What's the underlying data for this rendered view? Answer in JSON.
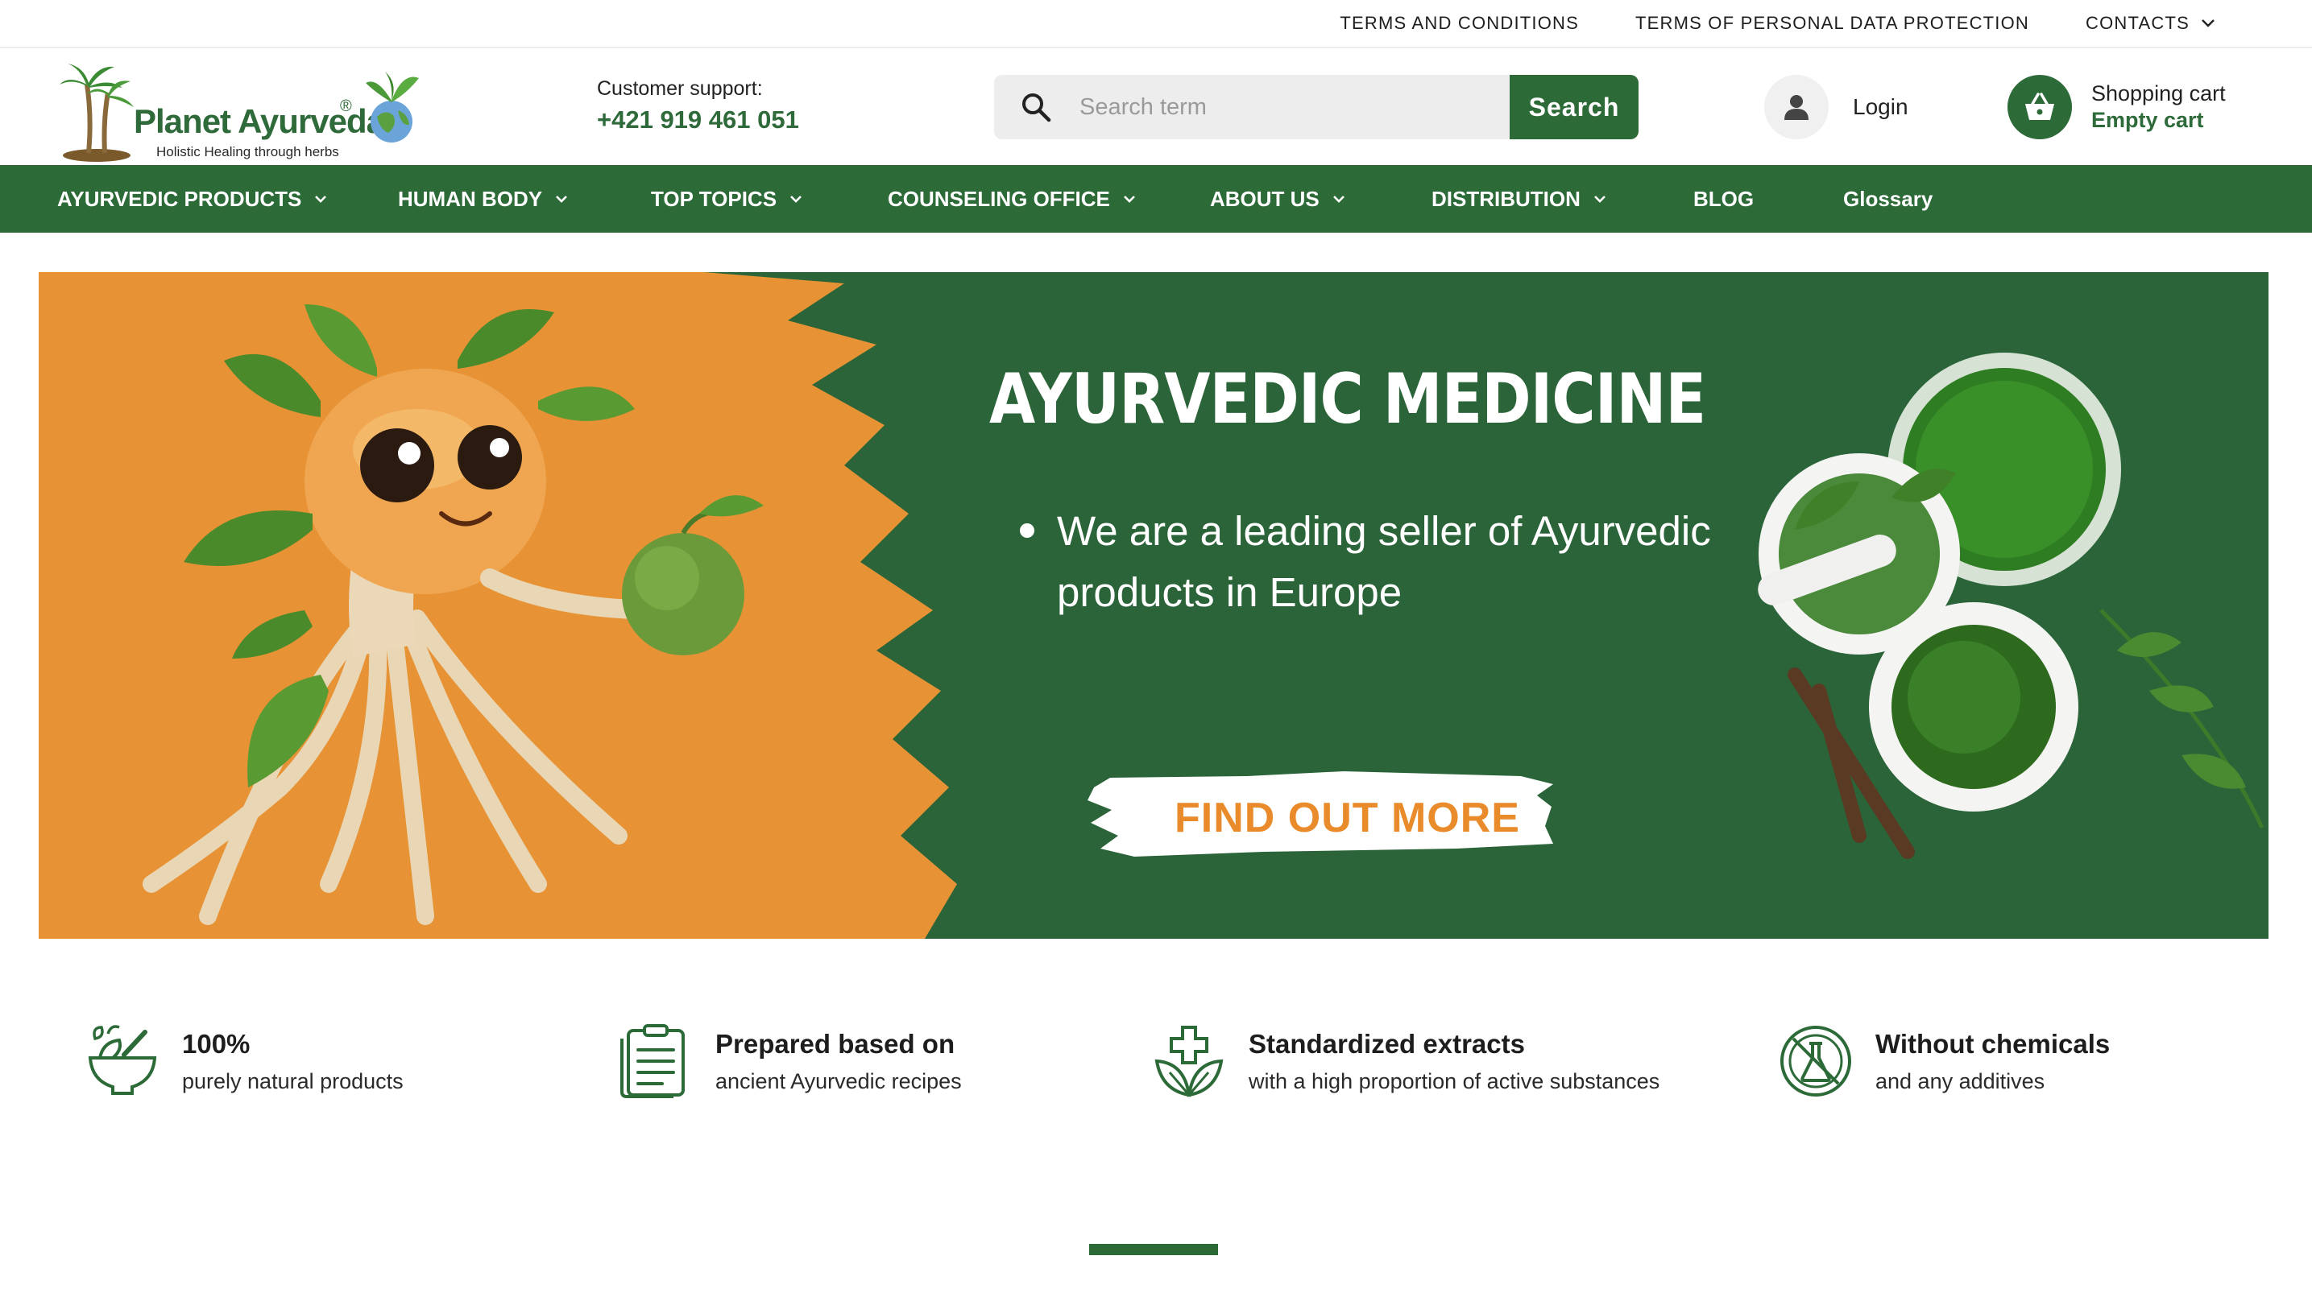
{
  "top_links": [
    "TERMS AND CONDITIONS",
    "TERMS OF PERSONAL DATA PROTECTION",
    "CONTACTS"
  ],
  "logo": {
    "name": "Planet Ayurveda",
    "reg": "®",
    "tagline": "Holistic Healing through herbs"
  },
  "support": {
    "label": "Customer support:",
    "phone": "+421 919 461 051"
  },
  "search": {
    "placeholder": "Search term",
    "button": "Search"
  },
  "login": {
    "label": "Login"
  },
  "cart": {
    "title": "Shopping cart",
    "status": "Empty cart"
  },
  "nav": [
    {
      "label": "AYURVEDIC PRODUCTS",
      "dropdown": true
    },
    {
      "label": "HUMAN BODY",
      "dropdown": true
    },
    {
      "label": "TOP TOPICS",
      "dropdown": true
    },
    {
      "label": "COUNSELING OFFICE",
      "dropdown": true
    },
    {
      "label": "ABOUT US",
      "dropdown": true
    },
    {
      "label": "DISTRIBUTION",
      "dropdown": true
    },
    {
      "label": "BLOG",
      "dropdown": false
    },
    {
      "label": "Glossary",
      "dropdown": false
    }
  ],
  "hero": {
    "title": "AYURVEDIC MEDICINE",
    "bullet": "We are a leading seller of Ayurvedic products in Europe",
    "cta": "FIND OUT MORE"
  },
  "features": [
    {
      "title": "100%",
      "subtitle": "purely natural products",
      "icon": "mortar-herbs-icon"
    },
    {
      "title": "Prepared based on",
      "subtitle": "ancient Ayurvedic recipes",
      "icon": "recipe-document-icon"
    },
    {
      "title": "Standardized extracts",
      "subtitle": "with a high proportion of active substances",
      "icon": "leaf-cross-icon"
    },
    {
      "title": "Without chemicals",
      "subtitle": "and any additives",
      "icon": "no-chemicals-flask-icon"
    }
  ],
  "colors": {
    "brand_green": "#2c6a38",
    "banner_orange": "#e69235",
    "cta_orange": "#e98b2a"
  }
}
